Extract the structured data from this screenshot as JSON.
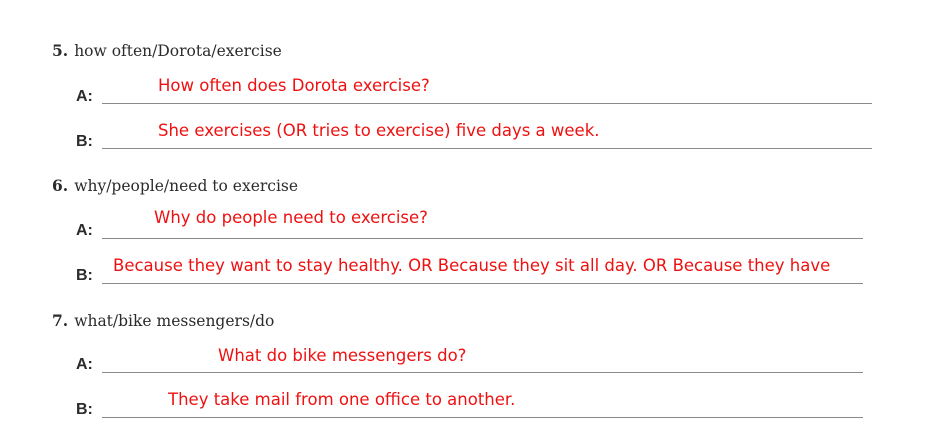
{
  "questions": [
    {
      "number": "5.",
      "prompt": "how often/Dorota/exercise",
      "a_label": "A:",
      "a_answer": "How often does Dorota exercise?",
      "b_label": "B:",
      "b_answer": "She exercises (OR tries to exercise) five days a week."
    },
    {
      "number": "6.",
      "prompt": "why/people/need to exercise",
      "a_label": "A:",
      "a_answer": "Why do people need to exercise?",
      "b_label": "B:",
      "b_answer": "Because they want to stay healthy. OR Because they sit all day. OR Because they have"
    },
    {
      "number": "7.",
      "prompt": "what/bike messengers/do",
      "a_label": "A:",
      "a_answer": "What do bike messengers do?",
      "b_label": "B:",
      "b_answer": "They take mail from one office to another."
    }
  ],
  "colors": {
    "answer": "#ee1111",
    "text": "#2b2b2b",
    "rule": "#8a8a8a"
  }
}
